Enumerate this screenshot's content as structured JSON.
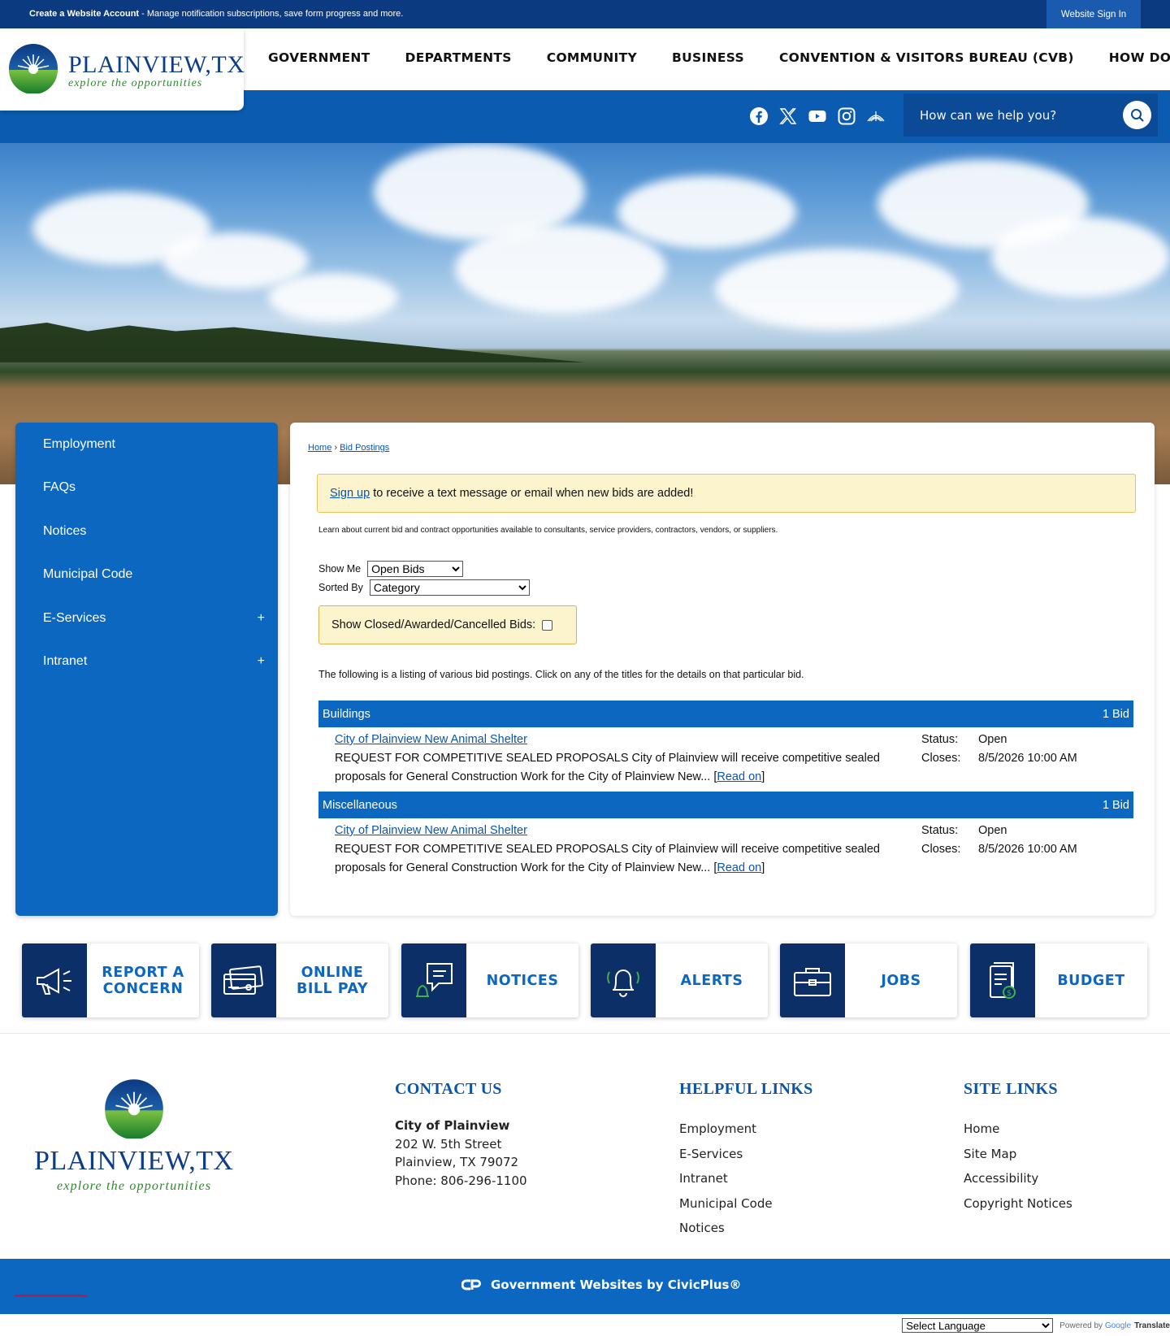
{
  "topbar": {
    "create_bold": "Create a Website Account",
    "create_rest": " - Manage notification subscriptions, save form progress and more.",
    "signin": "Website Sign In"
  },
  "logo": {
    "wordmark": "PLAINVIEW,TX",
    "tagline": "explore the opportunities"
  },
  "nav": [
    "GOVERNMENT",
    "DEPARTMENTS",
    "COMMUNITY",
    "BUSINESS",
    "CONVENTION & VISITORS BUREAU (CVB)",
    "HOW DO I..."
  ],
  "social_icons": [
    "facebook-icon",
    "x-twitter-icon",
    "youtube-icon",
    "instagram-icon",
    "wheat-icon"
  ],
  "search": {
    "placeholder": "How can we help you?"
  },
  "sidenav": {
    "items": [
      {
        "label": "Employment",
        "expand": ""
      },
      {
        "label": "FAQs",
        "expand": ""
      },
      {
        "label": "Notices",
        "expand": ""
      },
      {
        "label": "Municipal Code",
        "expand": ""
      },
      {
        "label": "E-Services",
        "expand": "+"
      },
      {
        "label": "Intranet",
        "expand": "+"
      }
    ]
  },
  "breadcrumb": {
    "home": "Home",
    "sep": " › ",
    "current": "Bid Postings"
  },
  "signup": {
    "link": "Sign up",
    "text": " to receive a text message or email when new bids are added!"
  },
  "intro": "Learn about current bid and contract opportunities available to consultants, service providers, contractors, vendors, or suppliers.",
  "filters": {
    "show_me_label": "Show Me",
    "show_me_value": "Open Bids",
    "sorted_by_label": "Sorted By",
    "sorted_by_value": "Category"
  },
  "closed_label": "Show Closed/Awarded/Cancelled Bids:",
  "listing_text": "The following is a listing of various bid postings. Click on any of the titles for the details on that particular bid.",
  "categories": [
    {
      "name": "Buildings",
      "count": "1 Bid",
      "bid": {
        "title": "City of Plainview New Animal Shelter",
        "desc": "REQUEST FOR COMPETITIVE SEALED PROPOSALS City of Plainview will receive competitive sealed proposals for General Construction Work for the City of Plainview New... ",
        "read_on": "Read on",
        "status_label": "Status:",
        "status": "Open",
        "closes_label": "Closes:",
        "closes": "8/5/2026 10:00 AM"
      }
    },
    {
      "name": "Miscellaneous",
      "count": "1 Bid",
      "bid": {
        "title": "City of Plainview New Animal Shelter",
        "desc": "REQUEST FOR COMPETITIVE SEALED PROPOSALS City of Plainview will receive competitive sealed proposals for General Construction Work for the City of Plainview New... ",
        "read_on": "Read on",
        "status_label": "Status:",
        "status": "Open",
        "closes_label": "Closes:",
        "closes": "8/5/2026 10:00 AM"
      }
    }
  ],
  "quick_links": [
    {
      "label": "REPORT A CONCERN",
      "icon": "megaphone-icon"
    },
    {
      "label": "ONLINE BILL PAY",
      "icon": "credit-card-icon"
    },
    {
      "label": "NOTICES",
      "icon": "chat-bell-icon"
    },
    {
      "label": "ALERTS",
      "icon": "bell-icon"
    },
    {
      "label": "JOBS",
      "icon": "briefcase-icon"
    },
    {
      "label": "BUDGET",
      "icon": "document-dollar-icon"
    }
  ],
  "footer": {
    "contact": {
      "heading": "CONTACT US",
      "name": "City of Plainview",
      "street": "202 W. 5th Street",
      "city": "Plainview, TX 79072",
      "phone": "Phone: 806-296-1100"
    },
    "helpful": {
      "heading": "HELPFUL LINKS",
      "links": [
        "Employment",
        "E-Services",
        "Intranet",
        "Municipal Code",
        "Notices"
      ]
    },
    "site": {
      "heading": "SITE LINKS",
      "links": [
        "Home",
        "Site Map",
        "Accessibility",
        "Copyright Notices"
      ]
    }
  },
  "credits": "Government Websites by CivicPlus®",
  "translate": {
    "select": "Select Language",
    "powered": "Powered by",
    "google": "Google",
    "translate": "Translate"
  },
  "colors": {
    "navy": "#0c3a80",
    "blue": "#0b67bf",
    "tile_icon_bg": "#0b2f66",
    "notice_bg": "#fbf4cc"
  }
}
